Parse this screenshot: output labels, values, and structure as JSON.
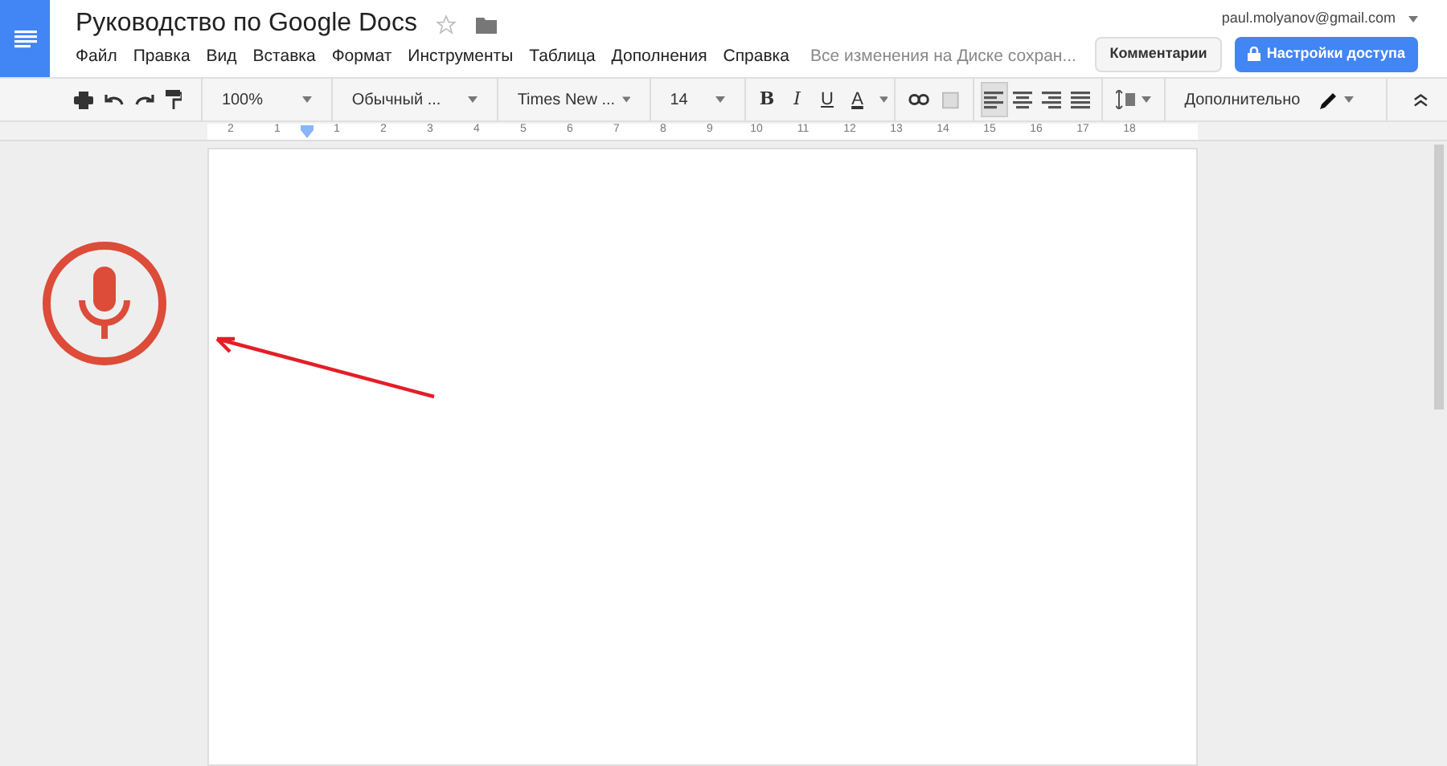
{
  "title": "Руководство по Google Docs",
  "starred": false,
  "menu": [
    "Файл",
    "Правка",
    "Вид",
    "Вставка",
    "Формат",
    "Инструменты",
    "Таблица",
    "Дополнения",
    "Справка"
  ],
  "save_status": "Все изменения на Диске сохран...",
  "account": "paul.molyanov@gmail.com",
  "comments_button": "Комментарии",
  "share_button": "Настройки доступа",
  "toolbar": {
    "zoom": "100%",
    "style": "Обычный ...",
    "font": "Times New ...",
    "size": "14",
    "format": [
      {
        "kind": "bold",
        "label": "B"
      },
      {
        "kind": "italic",
        "label": "I"
      },
      {
        "kind": "underline",
        "label": "U"
      },
      {
        "kind": "color",
        "label": "A"
      }
    ],
    "align": [
      {
        "kind": "left",
        "selected": true
      },
      {
        "kind": "center",
        "selected": false
      },
      {
        "kind": "right",
        "selected": false
      },
      {
        "kind": "justify",
        "selected": false
      }
    ],
    "more": "Дополнительно"
  },
  "ruler": [
    "2",
    "1",
    "1",
    "2",
    "3",
    "4",
    "5",
    "6",
    "7",
    "8",
    "9",
    "10",
    "11",
    "12",
    "13",
    "14",
    "15",
    "16",
    "17",
    "18"
  ]
}
